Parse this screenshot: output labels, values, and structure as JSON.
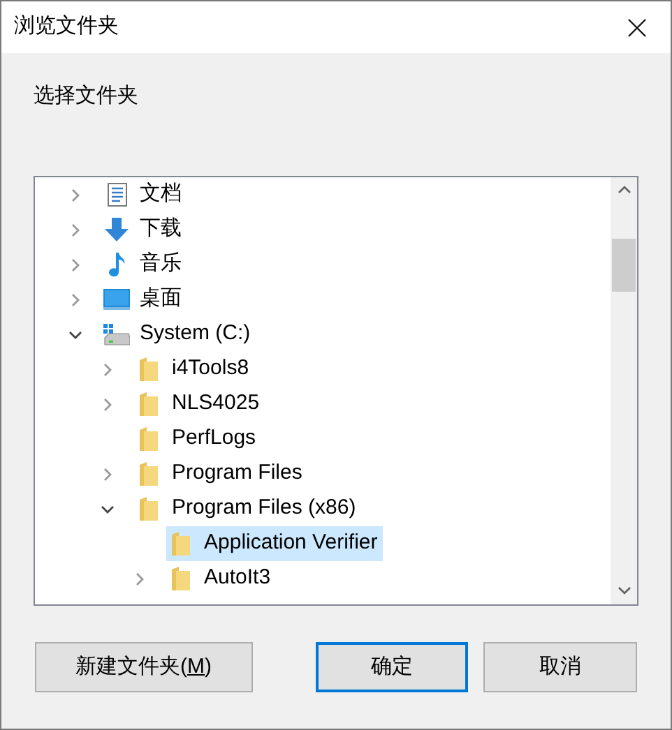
{
  "window": {
    "title": "浏览文件夹"
  },
  "prompt": "选择文件夹",
  "tree": [
    {
      "label": "文档",
      "kind": "document",
      "expanded": false,
      "selected": false
    },
    {
      "label": "下载",
      "kind": "download",
      "expanded": false,
      "selected": false
    },
    {
      "label": "音乐",
      "kind": "music",
      "expanded": false,
      "selected": false
    },
    {
      "label": "桌面",
      "kind": "desktop",
      "expanded": false,
      "selected": false
    },
    {
      "label": "System (C:)",
      "kind": "drive",
      "expanded": true,
      "selected": false,
      "children": [
        {
          "label": "i4Tools8",
          "kind": "folder",
          "expanded": false,
          "selected": false
        },
        {
          "label": "NLS4025",
          "kind": "folder",
          "expanded": false,
          "selected": false
        },
        {
          "label": "PerfLogs",
          "kind": "folder",
          "selected": false
        },
        {
          "label": "Program Files",
          "kind": "folder",
          "expanded": false,
          "selected": false
        },
        {
          "label": "Program Files (x86)",
          "kind": "folder",
          "expanded": true,
          "selected": false,
          "children": [
            {
              "label": "Application Verifier",
              "kind": "folder",
              "selected": true
            },
            {
              "label": "AutoIt3",
              "kind": "folder",
              "expanded": false,
              "selected": false
            }
          ]
        }
      ]
    }
  ],
  "buttons": [
    {
      "label_before": "新建文件夹(",
      "access_key": "M",
      "label_after": ")",
      "default": false
    },
    {
      "label_before": "确定",
      "default": true
    },
    {
      "label_before": "取消",
      "default": false
    }
  ]
}
